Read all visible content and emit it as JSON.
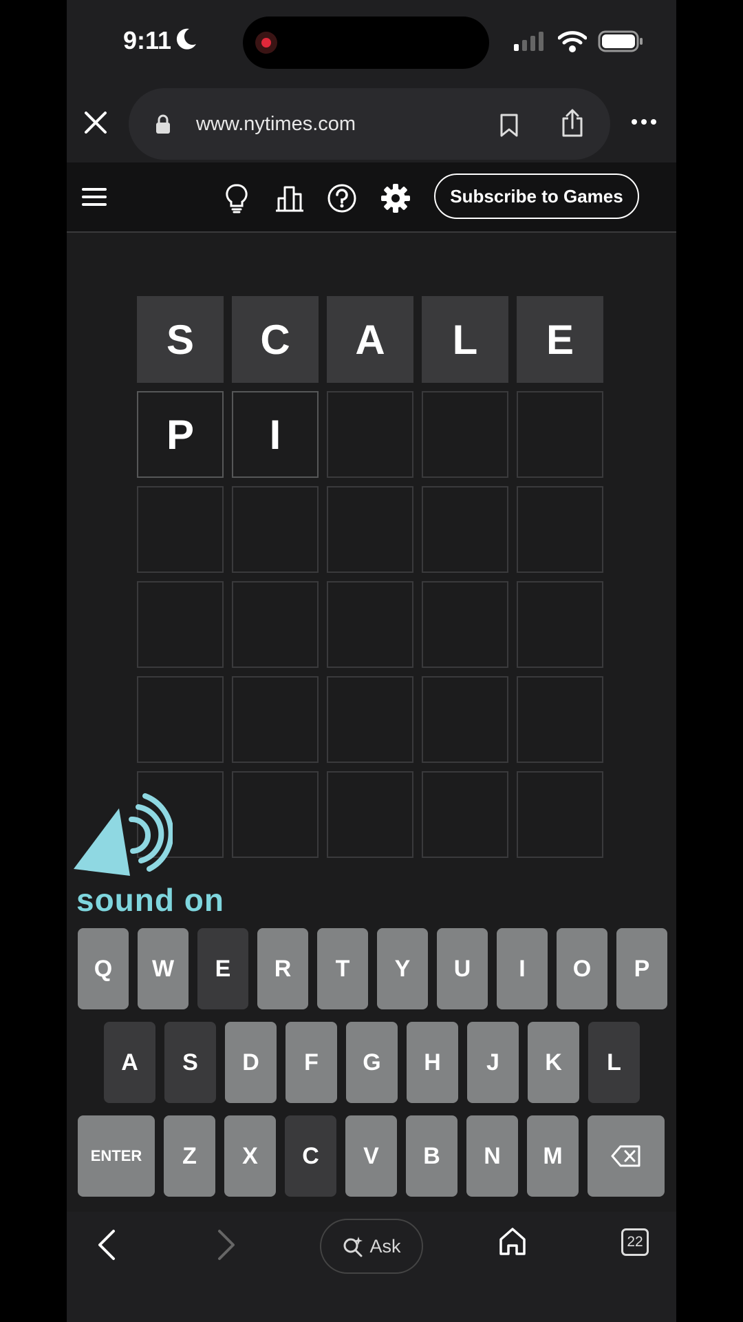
{
  "status_bar": {
    "time": "9:11"
  },
  "browser": {
    "url": "www.nytimes.com"
  },
  "game_header": {
    "subscribe_label": "Subscribe to Games"
  },
  "board": {
    "rows": [
      [
        {
          "letter": "S",
          "state": "absent"
        },
        {
          "letter": "C",
          "state": "absent"
        },
        {
          "letter": "A",
          "state": "absent"
        },
        {
          "letter": "L",
          "state": "absent"
        },
        {
          "letter": "E",
          "state": "absent"
        }
      ],
      [
        {
          "letter": "P",
          "state": "tbd"
        },
        {
          "letter": "I",
          "state": "tbd"
        },
        {
          "letter": "",
          "state": "empty"
        },
        {
          "letter": "",
          "state": "empty"
        },
        {
          "letter": "",
          "state": "empty"
        }
      ],
      [
        {
          "letter": "",
          "state": "empty"
        },
        {
          "letter": "",
          "state": "empty"
        },
        {
          "letter": "",
          "state": "empty"
        },
        {
          "letter": "",
          "state": "empty"
        },
        {
          "letter": "",
          "state": "empty"
        }
      ],
      [
        {
          "letter": "",
          "state": "empty"
        },
        {
          "letter": "",
          "state": "empty"
        },
        {
          "letter": "",
          "state": "empty"
        },
        {
          "letter": "",
          "state": "empty"
        },
        {
          "letter": "",
          "state": "empty"
        }
      ],
      [
        {
          "letter": "",
          "state": "empty"
        },
        {
          "letter": "",
          "state": "empty"
        },
        {
          "letter": "",
          "state": "empty"
        },
        {
          "letter": "",
          "state": "empty"
        },
        {
          "letter": "",
          "state": "empty"
        }
      ],
      [
        {
          "letter": "",
          "state": "empty"
        },
        {
          "letter": "",
          "state": "empty"
        },
        {
          "letter": "",
          "state": "empty"
        },
        {
          "letter": "",
          "state": "empty"
        },
        {
          "letter": "",
          "state": "empty"
        }
      ]
    ]
  },
  "overlay": {
    "sound_label": "sound on"
  },
  "keyboard": {
    "rows": [
      [
        {
          "label": "Q",
          "state": "unused"
        },
        {
          "label": "W",
          "state": "unused"
        },
        {
          "label": "E",
          "state": "absent"
        },
        {
          "label": "R",
          "state": "unused"
        },
        {
          "label": "T",
          "state": "unused"
        },
        {
          "label": "Y",
          "state": "unused"
        },
        {
          "label": "U",
          "state": "unused"
        },
        {
          "label": "I",
          "state": "unused"
        },
        {
          "label": "O",
          "state": "unused"
        },
        {
          "label": "P",
          "state": "unused"
        }
      ],
      [
        {
          "label": "A",
          "state": "absent"
        },
        {
          "label": "S",
          "state": "absent"
        },
        {
          "label": "D",
          "state": "unused"
        },
        {
          "label": "F",
          "state": "unused"
        },
        {
          "label": "G",
          "state": "unused"
        },
        {
          "label": "H",
          "state": "unused"
        },
        {
          "label": "J",
          "state": "unused"
        },
        {
          "label": "K",
          "state": "unused"
        },
        {
          "label": "L",
          "state": "absent"
        }
      ],
      [
        {
          "label": "ENTER",
          "state": "unused"
        },
        {
          "label": "Z",
          "state": "unused"
        },
        {
          "label": "X",
          "state": "unused"
        },
        {
          "label": "C",
          "state": "absent"
        },
        {
          "label": "V",
          "state": "unused"
        },
        {
          "label": "B",
          "state": "unused"
        },
        {
          "label": "N",
          "state": "unused"
        },
        {
          "label": "M",
          "state": "unused"
        },
        {
          "label": "",
          "icon": "backspace-icon",
          "state": "unused"
        }
      ]
    ]
  },
  "toolbar": {
    "ask_label": "Ask",
    "tab_count": "22"
  },
  "colors": {
    "absent": "#3a3a3c",
    "unused_key": "#818384",
    "sound_accent": "#7fd6de"
  }
}
